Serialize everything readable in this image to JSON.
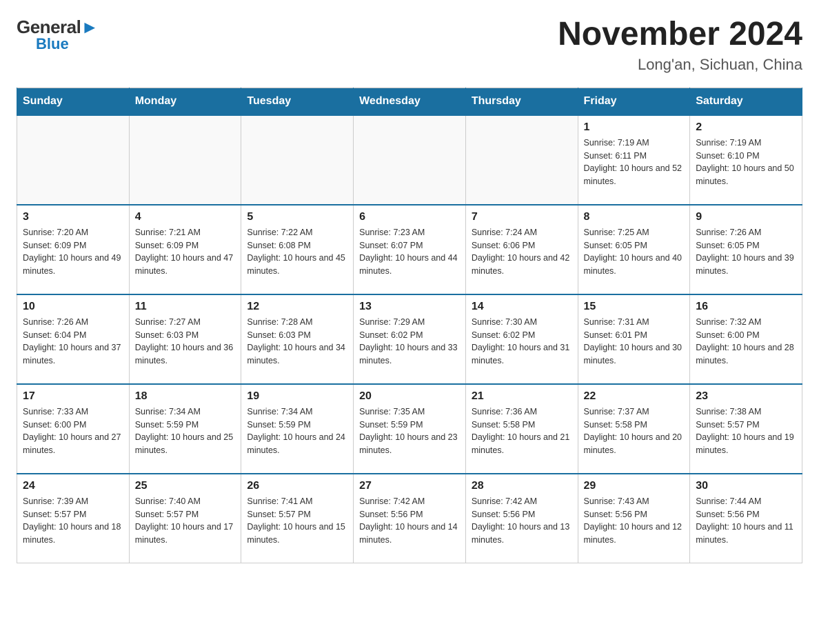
{
  "header": {
    "logo_general": "General",
    "logo_blue": "Blue",
    "month_year": "November 2024",
    "location": "Long'an, Sichuan, China"
  },
  "days_of_week": [
    "Sunday",
    "Monday",
    "Tuesday",
    "Wednesday",
    "Thursday",
    "Friday",
    "Saturday"
  ],
  "weeks": [
    [
      {
        "day": "",
        "info": ""
      },
      {
        "day": "",
        "info": ""
      },
      {
        "day": "",
        "info": ""
      },
      {
        "day": "",
        "info": ""
      },
      {
        "day": "",
        "info": ""
      },
      {
        "day": "1",
        "info": "Sunrise: 7:19 AM\nSunset: 6:11 PM\nDaylight: 10 hours and 52 minutes."
      },
      {
        "day": "2",
        "info": "Sunrise: 7:19 AM\nSunset: 6:10 PM\nDaylight: 10 hours and 50 minutes."
      }
    ],
    [
      {
        "day": "3",
        "info": "Sunrise: 7:20 AM\nSunset: 6:09 PM\nDaylight: 10 hours and 49 minutes."
      },
      {
        "day": "4",
        "info": "Sunrise: 7:21 AM\nSunset: 6:09 PM\nDaylight: 10 hours and 47 minutes."
      },
      {
        "day": "5",
        "info": "Sunrise: 7:22 AM\nSunset: 6:08 PM\nDaylight: 10 hours and 45 minutes."
      },
      {
        "day": "6",
        "info": "Sunrise: 7:23 AM\nSunset: 6:07 PM\nDaylight: 10 hours and 44 minutes."
      },
      {
        "day": "7",
        "info": "Sunrise: 7:24 AM\nSunset: 6:06 PM\nDaylight: 10 hours and 42 minutes."
      },
      {
        "day": "8",
        "info": "Sunrise: 7:25 AM\nSunset: 6:05 PM\nDaylight: 10 hours and 40 minutes."
      },
      {
        "day": "9",
        "info": "Sunrise: 7:26 AM\nSunset: 6:05 PM\nDaylight: 10 hours and 39 minutes."
      }
    ],
    [
      {
        "day": "10",
        "info": "Sunrise: 7:26 AM\nSunset: 6:04 PM\nDaylight: 10 hours and 37 minutes."
      },
      {
        "day": "11",
        "info": "Sunrise: 7:27 AM\nSunset: 6:03 PM\nDaylight: 10 hours and 36 minutes."
      },
      {
        "day": "12",
        "info": "Sunrise: 7:28 AM\nSunset: 6:03 PM\nDaylight: 10 hours and 34 minutes."
      },
      {
        "day": "13",
        "info": "Sunrise: 7:29 AM\nSunset: 6:02 PM\nDaylight: 10 hours and 33 minutes."
      },
      {
        "day": "14",
        "info": "Sunrise: 7:30 AM\nSunset: 6:02 PM\nDaylight: 10 hours and 31 minutes."
      },
      {
        "day": "15",
        "info": "Sunrise: 7:31 AM\nSunset: 6:01 PM\nDaylight: 10 hours and 30 minutes."
      },
      {
        "day": "16",
        "info": "Sunrise: 7:32 AM\nSunset: 6:00 PM\nDaylight: 10 hours and 28 minutes."
      }
    ],
    [
      {
        "day": "17",
        "info": "Sunrise: 7:33 AM\nSunset: 6:00 PM\nDaylight: 10 hours and 27 minutes."
      },
      {
        "day": "18",
        "info": "Sunrise: 7:34 AM\nSunset: 5:59 PM\nDaylight: 10 hours and 25 minutes."
      },
      {
        "day": "19",
        "info": "Sunrise: 7:34 AM\nSunset: 5:59 PM\nDaylight: 10 hours and 24 minutes."
      },
      {
        "day": "20",
        "info": "Sunrise: 7:35 AM\nSunset: 5:59 PM\nDaylight: 10 hours and 23 minutes."
      },
      {
        "day": "21",
        "info": "Sunrise: 7:36 AM\nSunset: 5:58 PM\nDaylight: 10 hours and 21 minutes."
      },
      {
        "day": "22",
        "info": "Sunrise: 7:37 AM\nSunset: 5:58 PM\nDaylight: 10 hours and 20 minutes."
      },
      {
        "day": "23",
        "info": "Sunrise: 7:38 AM\nSunset: 5:57 PM\nDaylight: 10 hours and 19 minutes."
      }
    ],
    [
      {
        "day": "24",
        "info": "Sunrise: 7:39 AM\nSunset: 5:57 PM\nDaylight: 10 hours and 18 minutes."
      },
      {
        "day": "25",
        "info": "Sunrise: 7:40 AM\nSunset: 5:57 PM\nDaylight: 10 hours and 17 minutes."
      },
      {
        "day": "26",
        "info": "Sunrise: 7:41 AM\nSunset: 5:57 PM\nDaylight: 10 hours and 15 minutes."
      },
      {
        "day": "27",
        "info": "Sunrise: 7:42 AM\nSunset: 5:56 PM\nDaylight: 10 hours and 14 minutes."
      },
      {
        "day": "28",
        "info": "Sunrise: 7:42 AM\nSunset: 5:56 PM\nDaylight: 10 hours and 13 minutes."
      },
      {
        "day": "29",
        "info": "Sunrise: 7:43 AM\nSunset: 5:56 PM\nDaylight: 10 hours and 12 minutes."
      },
      {
        "day": "30",
        "info": "Sunrise: 7:44 AM\nSunset: 5:56 PM\nDaylight: 10 hours and 11 minutes."
      }
    ]
  ]
}
